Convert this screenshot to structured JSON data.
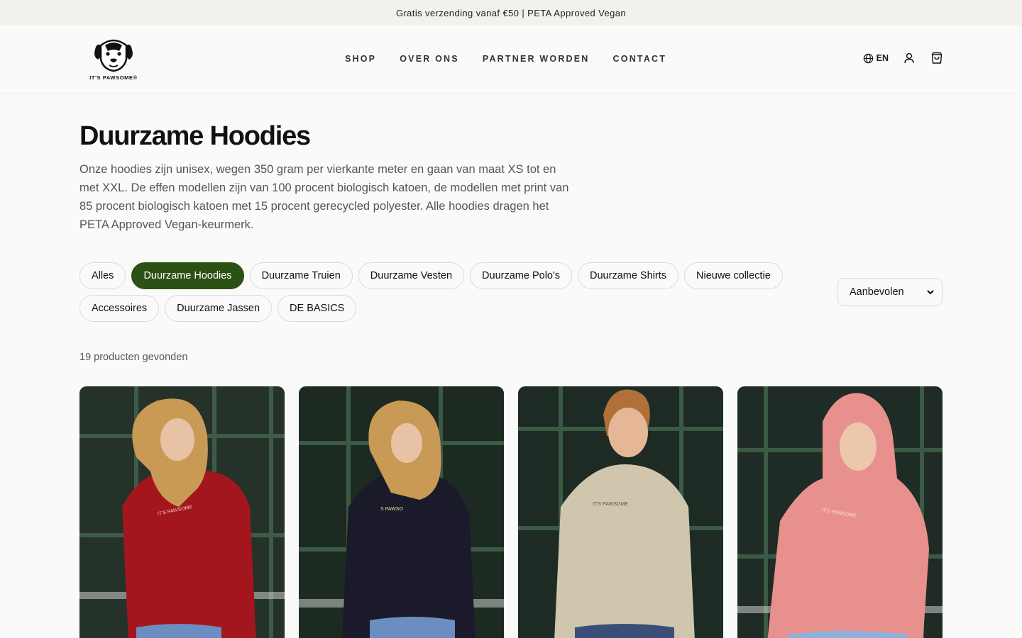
{
  "announcement": "Gratis verzending vanaf €50 | PETA Approved Vegan",
  "logo": {
    "text": "IT'S PAWSOME®"
  },
  "nav": [
    {
      "label": "SHOP"
    },
    {
      "label": "OVER ONS"
    },
    {
      "label": "PARTNER WORDEN"
    },
    {
      "label": "CONTACT"
    }
  ],
  "header": {
    "language": "EN",
    "icons": [
      "globe-icon",
      "account-icon",
      "cart-icon"
    ]
  },
  "page": {
    "title": "Duurzame Hoodies",
    "intro": "Onze hoodies zijn unisex, wegen 350 gram per vierkante meter en gaan van maat XS tot en met XXL. De effen modellen zijn van 100 procent biologisch katoen, de modellen met print van 85 procent biologisch katoen met 15 procent gerecycled polyester. Alle hoodies dragen het PETA Approved Vegan-keurmerk."
  },
  "filters": [
    {
      "label": "Alles",
      "active": false
    },
    {
      "label": "Duurzame Hoodies",
      "active": true
    },
    {
      "label": "Duurzame Truien",
      "active": false
    },
    {
      "label": "Duurzame Vesten",
      "active": false
    },
    {
      "label": "Duurzame Polo's",
      "active": false
    },
    {
      "label": "Duurzame Shirts",
      "active": false
    },
    {
      "label": "Nieuwe collectie",
      "active": false
    },
    {
      "label": "Accessoires",
      "active": false
    },
    {
      "label": "Duurzame Jassen",
      "active": false
    },
    {
      "label": "DE BASICS",
      "active": false
    }
  ],
  "sort": {
    "selected": "Aanbevolen"
  },
  "results": {
    "count_text": "19 producten gevonden"
  },
  "products": [
    {
      "hoodie_color": "#a3161e",
      "print_text": "IT'S PAWSOME"
    },
    {
      "hoodie_color": "#1a1a2a",
      "print_text": "S PAWSO"
    },
    {
      "hoodie_color": "#cfc6ad",
      "print_text": "IT'S PAWSOME"
    },
    {
      "hoodie_color": "#e8908d",
      "print_text": "IT'S PAWSOME"
    }
  ],
  "colors": {
    "accent": "#2c5114",
    "announce_bg": "#f2f1ee",
    "background": "#fafafa"
  }
}
